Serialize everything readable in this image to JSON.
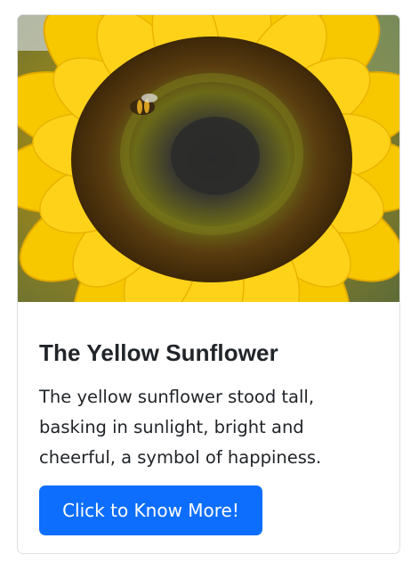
{
  "card": {
    "image_alt": "sunflower with a bee",
    "title": "The Yellow Sunflower",
    "text": "The yellow sunflower stood tall, basking in sunlight, bright and cheerful, a symbol of happiness.",
    "button_label": "Click to Know More!"
  },
  "colors": {
    "button_bg": "#0d6efd",
    "petal": "#f6c600",
    "center": "#3a2a10"
  }
}
